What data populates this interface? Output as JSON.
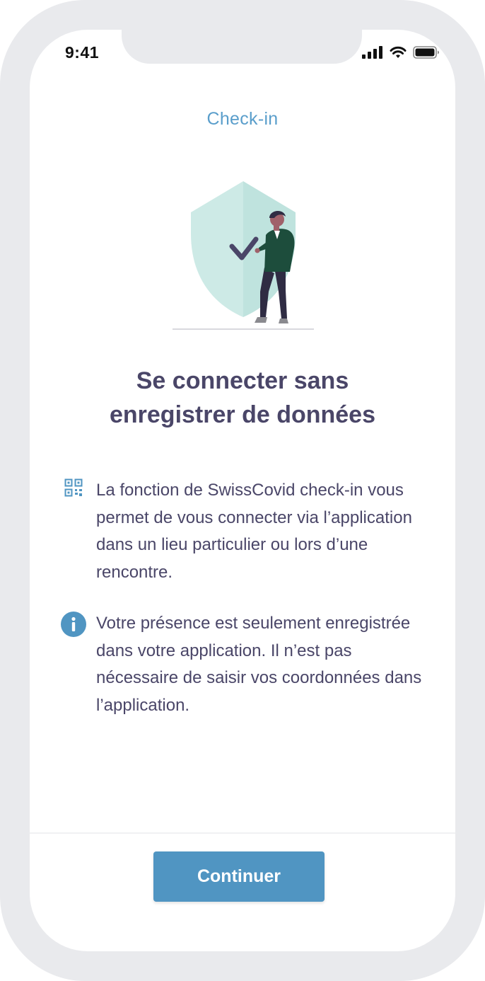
{
  "status_bar": {
    "time": "9:41",
    "icons": [
      "cellular-signal-icon",
      "wifi-icon",
      "battery-icon"
    ]
  },
  "nav": {
    "title": "Check-in"
  },
  "illustration": {
    "name": "shield-person-checkmark-illustration",
    "colors": {
      "shield_light": "#cdeae6",
      "shield_dark": "#bfe3de",
      "check": "#4a4668",
      "jacket": "#1d4d3c",
      "pants": "#2f2c43"
    }
  },
  "headline": {
    "line1": "Se connecter sans",
    "line2": "enregistrer de données"
  },
  "info": [
    {
      "icon": "qr-code-icon",
      "text": "La fonction de SwissCovid check-in vous permet de vous connecter via l’application dans un lieu particulier ou lors d’une rencontre."
    },
    {
      "icon": "info-icon",
      "text": "Votre présence est seulement enregistrée dans votre application. Il n’est pas nécessaire de saisir vos coordonnées dans l’application."
    }
  ],
  "footer": {
    "continue_label": "Continuer"
  },
  "colors": {
    "accent": "#5095c2",
    "title": "#5a9ecb",
    "text": "#4a4668",
    "frame": "#e9eaed"
  }
}
